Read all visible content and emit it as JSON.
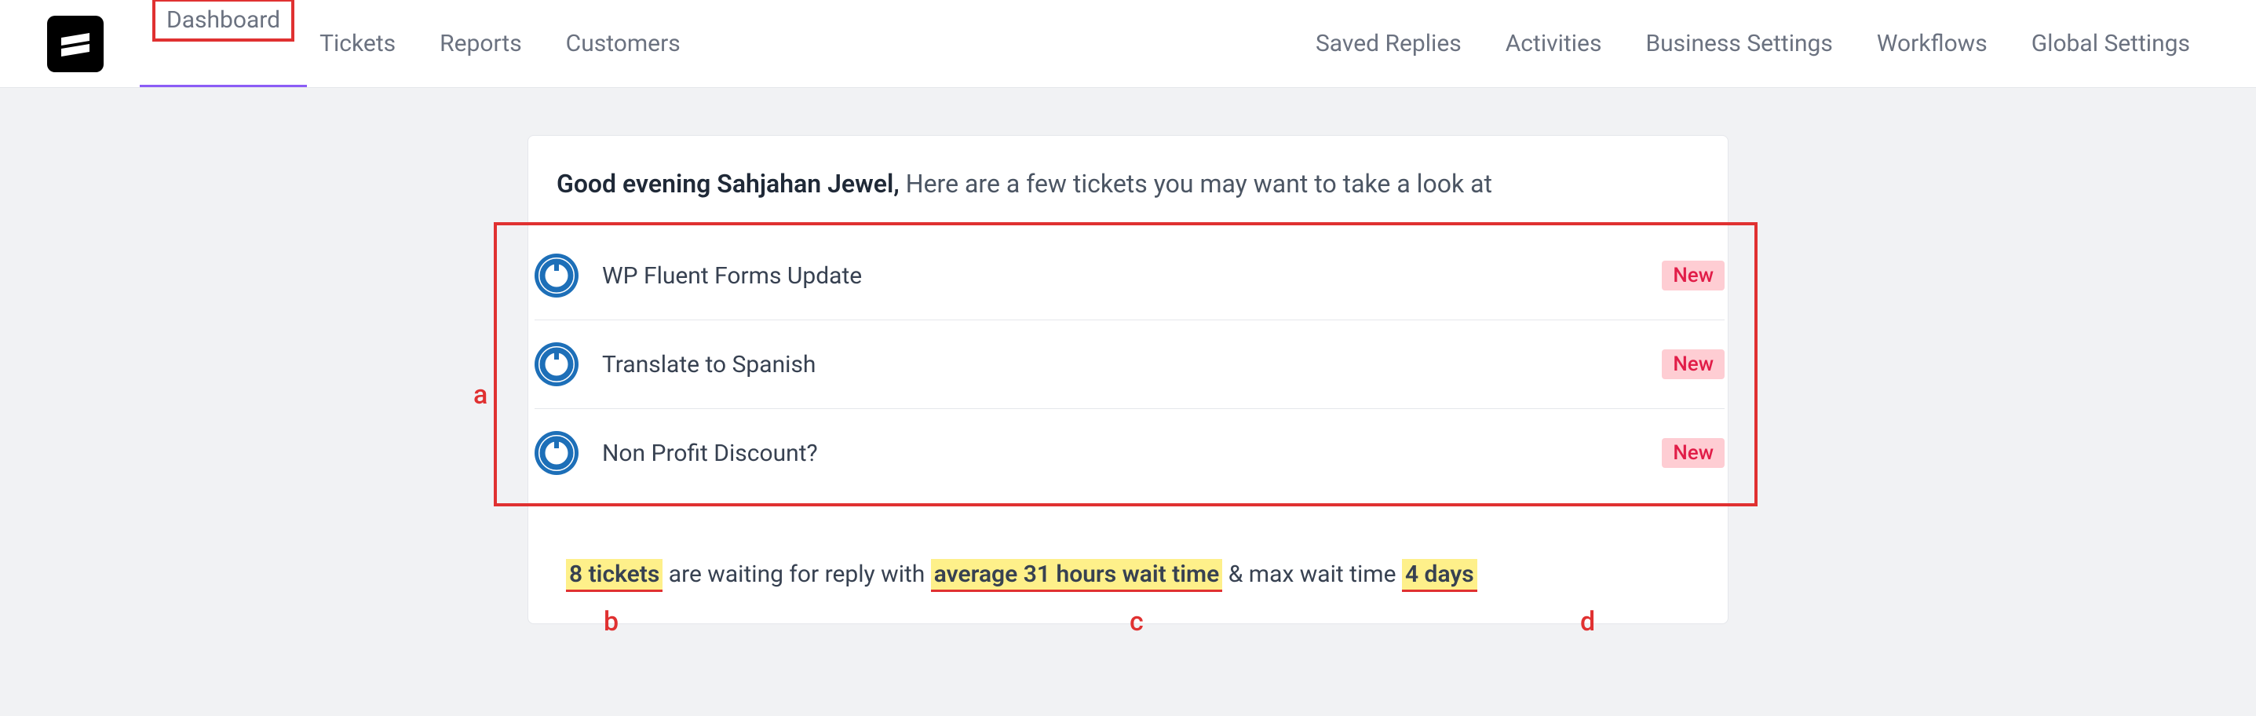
{
  "nav": {
    "left": [
      "Dashboard",
      "Tickets",
      "Reports",
      "Customers"
    ],
    "right": [
      "Saved Replies",
      "Activities",
      "Business Settings",
      "Workflows",
      "Global Settings"
    ],
    "active_index": 0
  },
  "greeting": {
    "strong": "Good evening Sahjahan Jewel,",
    "rest": " Here are a few tickets you may want to take a look at"
  },
  "tickets": [
    {
      "title": "WP Fluent Forms Update",
      "badge": "New"
    },
    {
      "title": "Translate to Spanish",
      "badge": "New"
    },
    {
      "title": "Non Profit Discount?",
      "badge": "New"
    }
  ],
  "stats": {
    "count": "8 tickets",
    "mid1": " are waiting for reply with ",
    "avg": "average 31 hours wait time",
    "mid2": " & max wait time ",
    "max": "4 days"
  },
  "annotations": {
    "a": "a",
    "b": "b",
    "c": "c",
    "d": "d"
  }
}
